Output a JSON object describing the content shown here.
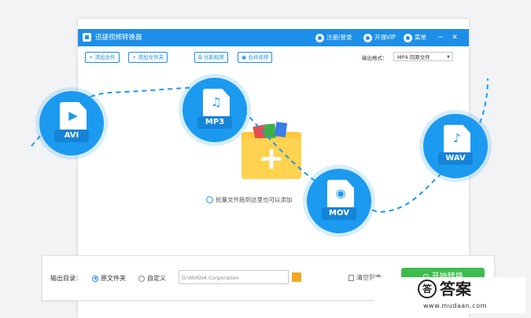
{
  "window": {
    "title": "迅捷视频转换器",
    "register_login": "注册/登录",
    "open_vip": "开通VIP",
    "menu": "菜单",
    "minimize": "−",
    "close": "✕"
  },
  "toolbar": {
    "add_file": "+ 添加文件",
    "add_folder": "+ 添加文件夹",
    "split_video": "分割视频",
    "merge_video": "合并视频",
    "output_format_label": "输出格式：",
    "output_format_value": "MP4 同原文件"
  },
  "drop_area": {
    "hint": "批量文件拖到这里也可以添加"
  },
  "formats": [
    {
      "label": "AVI",
      "icon": "video-camera-icon",
      "glyph": "▶"
    },
    {
      "label": "MP3",
      "icon": "music-note-icon",
      "glyph": "♫"
    },
    {
      "label": "MOV",
      "icon": "play-circle-icon",
      "glyph": "◉"
    },
    {
      "label": "WAV",
      "icon": "music-note-icon",
      "glyph": "♪"
    }
  ],
  "bottom": {
    "output_dir_label": "输出目录：",
    "radio_source": "原文件夹",
    "radio_custom": "自定义",
    "path": "D:\\NVIDIA Corporation",
    "clear_list": "清空列表",
    "start": "开始转换"
  },
  "watermark": {
    "logo_char": "答",
    "title": "答案",
    "url": "www.mudaan.com"
  },
  "colors": {
    "accent": "#1e8fe8",
    "badge": "#1b9af0",
    "start": "#3cbd4d",
    "folder": "#ffc83d"
  }
}
